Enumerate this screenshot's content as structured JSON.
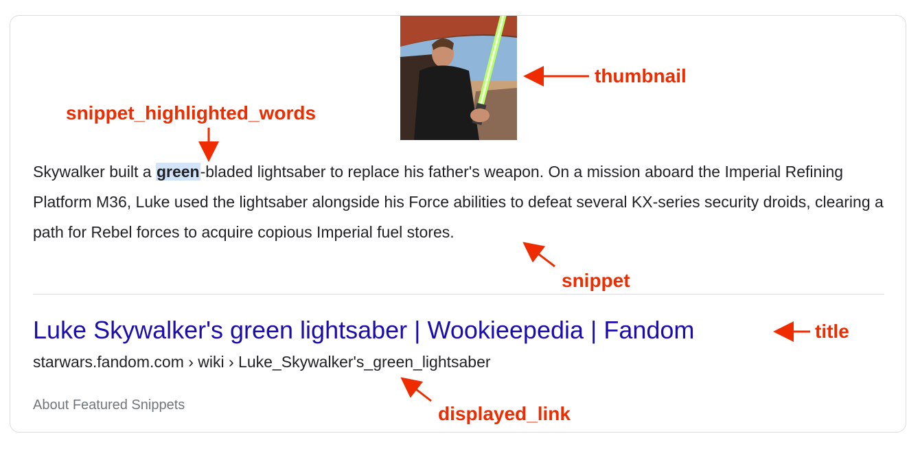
{
  "snippet": {
    "before": "Skywalker built a ",
    "highlight": "green",
    "after": "-bladed lightsaber to replace his father's weapon. On a mission aboard the Imperial Refining Platform M36, Luke used the lightsaber alongside his Force abilities to defeat several KX-series security droids, clearing a path for Rebel forces to acquire copious Imperial fuel stores."
  },
  "result": {
    "title": "Luke Skywalker's green lightsaber | Wookieepedia | Fandom",
    "displayed_link": "starwars.fandom.com › wiki › Luke_Skywalker's_green_lightsaber",
    "about": "About Featured Snippets"
  },
  "annotations": {
    "thumbnail": "thumbnail",
    "snippet_highlighted_words": "snippet_highlighted_words",
    "snippet": "snippet",
    "title": "title",
    "displayed_link": "displayed_link"
  },
  "colors": {
    "annotation": "#ee2c00",
    "title_link": "#1a0dab",
    "highlight_bg": "#d2e3fc"
  }
}
